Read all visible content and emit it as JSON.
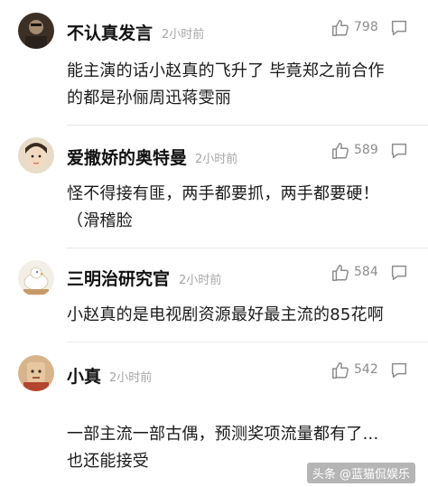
{
  "comments": [
    {
      "username": "不认真发言",
      "time": "2小时前",
      "likes": "798",
      "lines": [
        "能主演的话小赵真的飞升了 毕竟郑之前合作",
        "的都是孙俪周迅蒋雯丽"
      ],
      "avatar_color": "#5a4a3a"
    },
    {
      "username": "爱撒娇的奥特曼",
      "time": "2小时前",
      "likes": "589",
      "lines": [
        "怪不得接有匪，两手都要抓，两手都要硬！",
        "（滑稽脸"
      ],
      "avatar_color": "#d9c3a6"
    },
    {
      "username": "三明治研究官",
      "time": "2小时前",
      "likes": "584",
      "lines": [
        "小赵真的是电视剧资源最好最主流的85花啊"
      ],
      "avatar_color": "#f0ebe2"
    },
    {
      "username": "小真",
      "time": "2小时前",
      "likes": "542",
      "lines": [
        "一部主流一部古偶，预测奖项流量都有了...",
        "也还能接受"
      ],
      "avatar_color": "#c9a27a"
    }
  ],
  "icons": {
    "like": "thumbs-up-icon",
    "reply": "speech-bubble-icon"
  },
  "watermark": "头条 @蓝猫侃娱乐"
}
